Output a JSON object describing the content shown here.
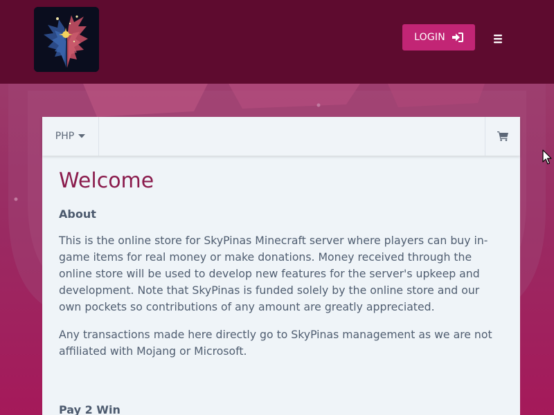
{
  "header": {
    "login_label": "LOGIN",
    "icons": {
      "login": "sign-in-icon",
      "menu": "hamburger-menu-icon",
      "logo": "skypinas-logo"
    }
  },
  "toolbar": {
    "currency": "PHP",
    "icons": {
      "caret": "caret-down-icon",
      "cart": "shopping-cart-icon"
    }
  },
  "content": {
    "title": "Welcome",
    "about_heading": "About",
    "paragraphs": [
      "This is the online store for SkyPinas Minecraft server where players can buy in-game items for real money or make donations. Money received through the online store will be used to develop new features for the server's upkeep and development. Note that SkyPinas is funded solely by the online store and our own pockets so contributions of any amount are greatly appreciated.",
      "Any transactions made here directly go to SkyPinas management as we are not affiliated with Mojang or Microsoft."
    ],
    "next_heading": "Pay 2 Win"
  },
  "colors": {
    "header_bg": "#5e0b2f",
    "accent": "#c22575",
    "title": "#8a1b4c",
    "card_bg": "#eff4f8",
    "text": "#4f5d70"
  }
}
